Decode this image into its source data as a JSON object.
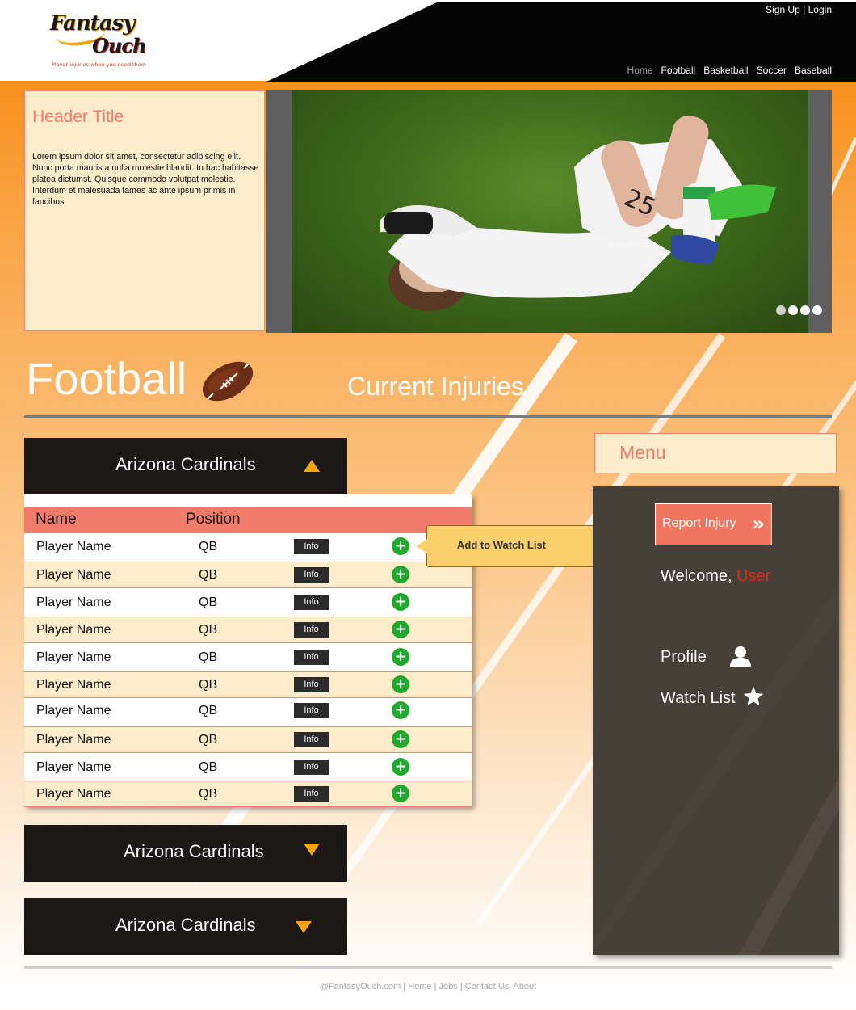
{
  "brand": {
    "name_line1": "Fantasy",
    "name_line2": "Ouch",
    "tagline": "Player injuries when you need them"
  },
  "auth": {
    "signup": "Sign Up",
    "separator": "|",
    "login": "Login"
  },
  "nav": {
    "items": [
      {
        "label": "Home"
      },
      {
        "label": "Football"
      },
      {
        "label": "Basketball"
      },
      {
        "label": "Soccer"
      },
      {
        "label": "Baseball"
      }
    ]
  },
  "hero": {
    "title": "Header Title",
    "body": "Lorem ipsum dolor sit amet, consectetur adipiscing elit. Nunc porta mauris a nulla molestie blandit. In hac habitasse platea dictumst. Quisque commodo volutpat molestie. Interdum et malesuada fames ac ante ipsum primis in faucibus",
    "slides": {
      "count": 4,
      "active_index": 0
    }
  },
  "section": {
    "title": "Football",
    "subtitle": "Current Injuries"
  },
  "teams": [
    {
      "name": "Arizona Cardinals",
      "expanded": true
    },
    {
      "name": "Arizona Cardinals",
      "expanded": false
    },
    {
      "name": "Arizona Cardinals",
      "expanded": false
    }
  ],
  "table": {
    "columns": {
      "name": "Name",
      "position": "Position"
    },
    "info_label": "Info",
    "add_icon": "+",
    "rows": [
      {
        "name": "Player Name",
        "position": "QB"
      },
      {
        "name": "Player Name",
        "position": "QB"
      },
      {
        "name": "Player Name",
        "position": "QB"
      },
      {
        "name": "Player Name",
        "position": "QB"
      },
      {
        "name": "Player Name",
        "position": "QB"
      },
      {
        "name": "Player Name",
        "position": "QB"
      },
      {
        "name": "Player Name",
        "position": "QB"
      },
      {
        "name": "Player Name",
        "position": "QB"
      },
      {
        "name": "Player Name",
        "position": "QB"
      },
      {
        "name": "Player Name",
        "position": "QB"
      }
    ]
  },
  "tooltip": {
    "text": "Add to Watch List"
  },
  "menu": {
    "title": "Menu",
    "report_label": "Report Injury",
    "welcome_prefix": "Welcome,",
    "user": "User",
    "profile": "Profile",
    "watchlist": "Watch List"
  },
  "footer": {
    "copyright": "@FantasyOuch.com",
    "links": [
      "Home",
      "Jobs",
      "Contact Us",
      "About"
    ]
  },
  "colors": {
    "accent_orange": "#f7901e",
    "salmon": "#ef7d6a",
    "cream": "#feeccb",
    "dark": "#1a1716",
    "panel": "#474039",
    "add_green": "#1faa2e",
    "arrow_gold": "#f6a410"
  }
}
